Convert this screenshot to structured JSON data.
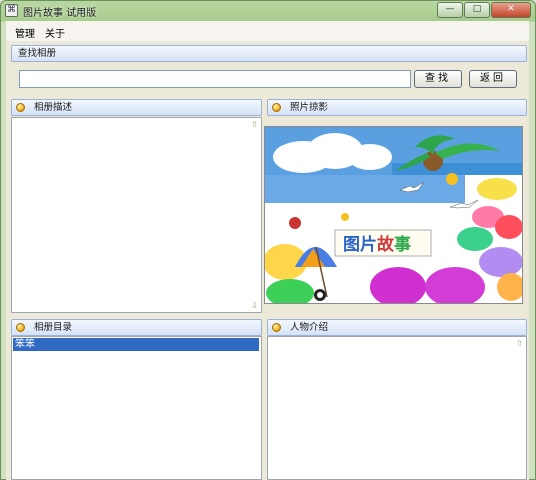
{
  "window": {
    "title": "图片故事 试用版",
    "icon_glyph": "⌘",
    "min": "—",
    "max": "□",
    "close": "✕"
  },
  "menu": {
    "items": [
      "管理",
      "关于"
    ]
  },
  "search": {
    "header": "查找相册",
    "value": "",
    "placeholder": "",
    "find_button": "查找",
    "back_button": "返回"
  },
  "panels": {
    "album_desc": {
      "header": "相册描述"
    },
    "photo_show": {
      "header": "照片掠影"
    },
    "album_dir": {
      "header": "相册目录",
      "items": [
        "笨笨"
      ]
    },
    "person_intro": {
      "header": "人物介绍"
    }
  },
  "photo": {
    "logo_text": "图片故事",
    "logo_colors": [
      "#2b63c9",
      "#2b63c9",
      "#d23b3b",
      "#2ea84a"
    ]
  },
  "colors": {
    "title_bar": "#a7cc8c",
    "panel_header": "#d4e2f6",
    "selection": "#316ac5"
  }
}
